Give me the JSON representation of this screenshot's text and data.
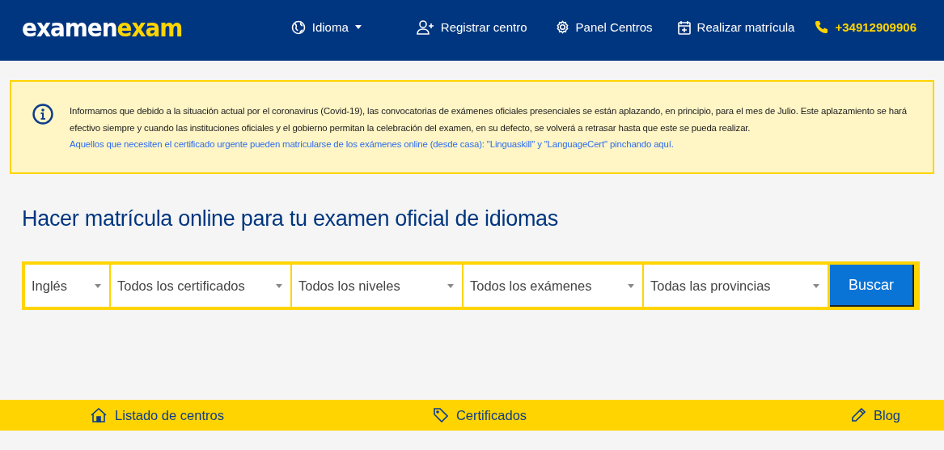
{
  "header": {
    "logo": {
      "part_1": "examen",
      "part_2": "exam"
    },
    "nav": [
      {
        "kind": "language",
        "label": "Idioma"
      },
      {
        "kind": "register",
        "label": "Registrar centro"
      },
      {
        "kind": "panel",
        "label": "Panel Centros"
      },
      {
        "kind": "enroll",
        "label": "Realizar matrícula"
      },
      {
        "kind": "phone",
        "label": "+34912909906"
      }
    ]
  },
  "notice": {
    "text": "Informamos que debido a la situación actual por el coronavirus (Covid-19), las convocatorias de exámenes oficiales presenciales se están aplazando, en principio, para el mes de Julio. Este aplazamiento se hará efectivo siempre y cuando las instituciones oficiales y el gobierno permitan la celebración del examen, en su defecto, se volverá a retrasar hasta que este se pueda realizar.",
    "link": "Aquellos que necesiten el certificado urgente pueden matricularse de los exámenes online (desde casa): \"Linguaskill\" y \"LanguageCert\" pinchando aquí."
  },
  "heading": "Hacer matrícula online para tu examen oficial de idiomas",
  "search": {
    "selects": [
      {
        "value": "Inglés"
      },
      {
        "value": "Todos los certificados"
      },
      {
        "value": "Todos los niveles"
      },
      {
        "value": "Todos los exámenes"
      },
      {
        "value": "Todas las provincias"
      }
    ],
    "button": "Buscar"
  },
  "footer_nav": [
    {
      "kind": "home",
      "label": "Listado de centros"
    },
    {
      "kind": "tag",
      "label": "Certificados"
    },
    {
      "kind": "pencil",
      "label": "Blog"
    }
  ]
}
